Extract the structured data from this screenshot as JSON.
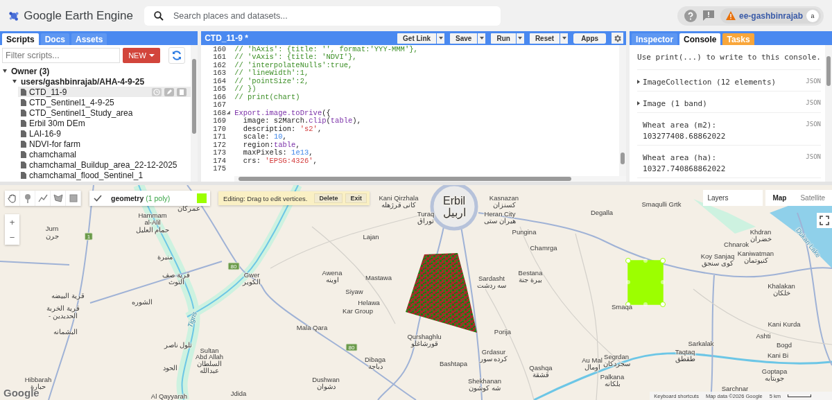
{
  "app": {
    "title": "Google Earth Engine"
  },
  "search": {
    "placeholder": "Search places and datasets..."
  },
  "account": {
    "project": "ee-gashbinrajab",
    "avatar": "a",
    "warning": true
  },
  "left_panel": {
    "tabs": [
      {
        "label": "Scripts",
        "selected": true
      },
      {
        "label": "Docs",
        "selected": false
      },
      {
        "label": "Assets",
        "selected": false
      }
    ],
    "filter": {
      "placeholder": "Filter scripts..."
    },
    "new_button": "NEW",
    "tree": [
      {
        "kind": "folder",
        "label": "Owner (3)",
        "expanded": true,
        "children": [
          {
            "kind": "folder",
            "label": "users/gashbinrajab/AHA-4-9-25",
            "expanded": true,
            "children": [
              {
                "kind": "script",
                "label": "CTD_11-9",
                "selected": true
              },
              {
                "kind": "script",
                "label": "CTD_Sentinel1_4-9-25",
                "selected": false
              },
              {
                "kind": "script",
                "label": "CTD_Sentinel1_Study_area",
                "selected": false
              },
              {
                "kind": "script",
                "label": "Erbil 30m DEm",
                "selected": false
              },
              {
                "kind": "script",
                "label": "LAI-16-9",
                "selected": false
              },
              {
                "kind": "script",
                "label": "NDVI-for farm",
                "selected": false
              },
              {
                "kind": "script",
                "label": "chamchamal",
                "selected": false
              },
              {
                "kind": "script",
                "label": "chamchamal_Buildup_area_22-12-2025",
                "selected": false
              },
              {
                "kind": "script",
                "label": "chamchamal_flood_Sentinel_1",
                "selected": false
              }
            ]
          }
        ]
      }
    ]
  },
  "editor": {
    "title": "CTD_11-9 *",
    "buttons": [
      {
        "label": "Get Link",
        "dropdown": true
      },
      {
        "label": "Save",
        "dropdown": true
      },
      {
        "label": "Run",
        "dropdown": true
      },
      {
        "label": "Reset",
        "dropdown": true
      },
      {
        "label": "Apps",
        "dropdown": false
      }
    ],
    "lines": [
      {
        "number": "160",
        "foldable": false,
        "segments": [
          {
            "kind": "comment",
            "text": "// 'hAxis': {title: '', format:'YYY-MMM'},"
          }
        ]
      },
      {
        "number": "161",
        "foldable": false,
        "segments": [
          {
            "kind": "comment",
            "text": "// 'vAxis': {title: 'NDVI'},"
          }
        ]
      },
      {
        "number": "162",
        "foldable": false,
        "segments": [
          {
            "kind": "comment",
            "text": "// 'interpolateNulls':true,"
          }
        ]
      },
      {
        "number": "163",
        "foldable": false,
        "segments": [
          {
            "kind": "comment",
            "text": "// 'lineWidth':1,"
          }
        ]
      },
      {
        "number": "164",
        "foldable": false,
        "segments": [
          {
            "kind": "comment",
            "text": "// 'pointSize':2,"
          }
        ]
      },
      {
        "number": "165",
        "foldable": false,
        "segments": [
          {
            "kind": "comment",
            "text": "// })"
          }
        ]
      },
      {
        "number": "166",
        "foldable": false,
        "segments": [
          {
            "kind": "comment",
            "text": "// print(chart)"
          }
        ]
      },
      {
        "number": "167",
        "foldable": false
      },
      {
        "number": "168",
        "foldable": true,
        "segments": [
          {
            "kind": "keyword",
            "text": "Export.image.toDrive"
          },
          {
            "kind": "plain",
            "text": "({"
          }
        ]
      },
      {
        "number": "169",
        "foldable": false,
        "segments": [
          {
            "kind": "plain",
            "text": "  image: s2March."
          },
          {
            "kind": "keyword",
            "text": "clip"
          },
          {
            "kind": "plain",
            "text": "("
          },
          {
            "kind": "keyword",
            "text": "table"
          },
          {
            "kind": "plain",
            "text": "),"
          }
        ]
      },
      {
        "number": "170",
        "foldable": false,
        "segments": [
          {
            "kind": "plain",
            "text": "  description: "
          },
          {
            "kind": "string",
            "text": "'s2'"
          },
          {
            "kind": "plain",
            "text": ","
          }
        ]
      },
      {
        "number": "171",
        "foldable": false,
        "segments": [
          {
            "kind": "plain",
            "text": "  scale: "
          },
          {
            "kind": "number",
            "text": "10"
          },
          {
            "kind": "plain",
            "text": ","
          }
        ]
      },
      {
        "number": "172",
        "foldable": false,
        "segments": [
          {
            "kind": "plain",
            "text": "  region:"
          },
          {
            "kind": "keyword",
            "text": "table"
          },
          {
            "kind": "plain",
            "text": ","
          }
        ]
      },
      {
        "number": "173",
        "foldable": false,
        "segments": [
          {
            "kind": "plain",
            "text": "  maxPixels: "
          },
          {
            "kind": "number",
            "text": "1e13"
          },
          {
            "kind": "plain",
            "text": ","
          }
        ]
      },
      {
        "number": "174",
        "foldable": false,
        "segments": [
          {
            "kind": "plain",
            "text": "  crs: "
          },
          {
            "kind": "string",
            "text": "'EPSG:4326'"
          },
          {
            "kind": "plain",
            "text": ","
          }
        ]
      },
      {
        "number": "175",
        "foldable": false
      }
    ]
  },
  "right_panel": {
    "tabs": [
      {
        "label": "Inspector",
        "selected": false,
        "highlighted": false
      },
      {
        "label": "Console",
        "selected": true,
        "highlighted": false
      },
      {
        "label": "Tasks",
        "selected": false,
        "highlighted": true
      }
    ],
    "console": {
      "hint": "Use print(...) to write to this console.",
      "entries": [
        {
          "kind": "collapsible",
          "text": "ImageCollection (12 elements)",
          "tag": "JSON"
        },
        {
          "kind": "collapsible",
          "text": "Image (1 band)",
          "tag": "JSON"
        },
        {
          "kind": "value",
          "text": "Wheat area (m2):",
          "value": "103277408.68862022",
          "tag": "JSON"
        },
        {
          "kind": "value",
          "text": "Wheat area (ha):",
          "value": "10327.740868862022",
          "tag": "JSON"
        }
      ]
    }
  },
  "map": {
    "tools": [
      {
        "kind": "hand"
      },
      {
        "kind": "point"
      },
      {
        "kind": "line"
      },
      {
        "kind": "polygon"
      },
      {
        "kind": "rectangle"
      }
    ],
    "layer": {
      "name": "geometry",
      "count": "(1 poly)",
      "visible": true,
      "color": "#9cff00"
    },
    "editing": {
      "message": "Editing: Drag to edit vertices.",
      "buttons": [
        "Delete",
        "Exit"
      ]
    },
    "zoom": [
      "+",
      "−"
    ],
    "layers_button": "Layers",
    "map_types": [
      {
        "label": "Map",
        "selected": true
      },
      {
        "label": "Satellite",
        "selected": false
      }
    ],
    "road_shields": [
      "1",
      "80",
      "80"
    ],
    "labels": [
      {
        "kind": "place",
        "text": "عمركان"
      },
      {
        "kind": "place",
        "text": "Hammam"
      },
      {
        "kind": "place",
        "text": "al-Alil"
      },
      {
        "kind": "place",
        "text": "Jurn"
      },
      {
        "kind": "place",
        "text": "حمام العليل"
      },
      {
        "kind": "place",
        "text": "جرن"
      },
      {
        "kind": "place",
        "text": "منيرة"
      },
      {
        "kind": "place",
        "text": "قرية صف"
      },
      {
        "kind": "place",
        "text": "التوث"
      },
      {
        "kind": "place",
        "text": "Gwer"
      },
      {
        "kind": "place",
        "text": "الكوير"
      },
      {
        "kind": "place",
        "text": "قرية البيضه"
      },
      {
        "kind": "place",
        "text": "الشوره"
      },
      {
        "kind": "place",
        "text": "قرية الخربة"
      },
      {
        "kind": "place",
        "text": "- الحديدين"
      },
      {
        "kind": "place",
        "text": "البشمانه"
      },
      {
        "kind": "river",
        "text": "Tigris"
      },
      {
        "kind": "place",
        "text": "تلول ناصر"
      },
      {
        "kind": "place",
        "text": "Sultan"
      },
      {
        "kind": "place",
        "text": "Abd Allah"
      },
      {
        "kind": "place",
        "text": "السلطان"
      },
      {
        "kind": "place",
        "text": "الحود"
      },
      {
        "kind": "place",
        "text": "عبدالله"
      },
      {
        "kind": "place",
        "text": "Hibbarah"
      },
      {
        "kind": "place",
        "text": "حبارة"
      },
      {
        "kind": "place",
        "text": "Al Qayyarah"
      },
      {
        "kind": "place",
        "text": "Jdida"
      },
      {
        "kind": "place",
        "text": "Dushwan"
      },
      {
        "kind": "place",
        "text": "دشوان"
      },
      {
        "kind": "place",
        "text": "Dibaga"
      },
      {
        "kind": "place",
        "text": "دباجة"
      },
      {
        "kind": "place",
        "text": "Mala Qara"
      },
      {
        "kind": "place",
        "text": "Mastawa"
      },
      {
        "kind": "place",
        "text": "Siyaw"
      },
      {
        "kind": "place",
        "text": "Helawa"
      },
      {
        "kind": "place",
        "text": "Kar Group"
      },
      {
        "kind": "place",
        "text": "Awena"
      },
      {
        "kind": "place",
        "text": "اوینه"
      },
      {
        "kind": "place",
        "text": "Lajan"
      },
      {
        "kind": "place",
        "text": "Kani Qirzhala"
      },
      {
        "kind": "place",
        "text": "کانی قرژهله"
      },
      {
        "kind": "city",
        "text": "Erbil"
      },
      {
        "kind": "city",
        "text": "اربيل"
      },
      {
        "kind": "place",
        "text": "Kasnazan"
      },
      {
        "kind": "place",
        "text": "کسنزان"
      },
      {
        "kind": "place",
        "text": "Turaq"
      },
      {
        "kind": "place",
        "text": "توراق"
      },
      {
        "kind": "place",
        "text": "Heran City"
      },
      {
        "kind": "place",
        "text": "هيران ستى"
      },
      {
        "kind": "place",
        "text": "Pungina"
      },
      {
        "kind": "place",
        "text": "Chamrga"
      },
      {
        "kind": "place",
        "text": "Degalla"
      },
      {
        "kind": "place",
        "text": "Smaqulli Grtk"
      },
      {
        "kind": "place",
        "text": "Sardasht"
      },
      {
        "kind": "place",
        "text": "سه ردشت"
      },
      {
        "kind": "place",
        "text": "Bestana"
      },
      {
        "kind": "place",
        "text": "بيرة جنة"
      },
      {
        "kind": "place",
        "text": "Khdran"
      },
      {
        "kind": "place",
        "text": "خضران"
      },
      {
        "kind": "place",
        "text": "Chnarok"
      },
      {
        "kind": "place",
        "text": "Koy Sanjaq"
      },
      {
        "kind": "place",
        "text": "كوى سنجق"
      },
      {
        "kind": "place",
        "text": "Kaniwatman"
      },
      {
        "kind": "place",
        "text": "كنيوتمان"
      },
      {
        "kind": "lake",
        "text": "Dukan Lake"
      },
      {
        "kind": "place",
        "text": "Khalakan"
      },
      {
        "kind": "place",
        "text": "خلكان"
      },
      {
        "kind": "place",
        "text": "Smaqa"
      },
      {
        "kind": "place",
        "text": "Porija"
      },
      {
        "kind": "place",
        "text": "Kani Kurda"
      },
      {
        "kind": "place",
        "text": "Ashti"
      },
      {
        "kind": "place",
        "text": "Grdasur"
      },
      {
        "kind": "place",
        "text": "كرده سور"
      },
      {
        "kind": "place",
        "text": "Sarkalak"
      },
      {
        "kind": "place",
        "text": "Taqtaq"
      },
      {
        "kind": "place",
        "text": "طقطق"
      },
      {
        "kind": "place",
        "text": "Bogd"
      },
      {
        "kind": "place",
        "text": "Bashtapa"
      },
      {
        "kind": "place",
        "text": "Au Mal"
      },
      {
        "kind": "place",
        "text": "اومال"
      },
      {
        "kind": "place",
        "text": "Segrdan"
      },
      {
        "kind": "place",
        "text": "سجردكان"
      },
      {
        "kind": "place",
        "text": "Qashqa"
      },
      {
        "kind": "place",
        "text": "قشقة"
      },
      {
        "kind": "place",
        "text": "Kani Bi"
      },
      {
        "kind": "place",
        "text": "Goptapa"
      },
      {
        "kind": "place",
        "text": "Palkana"
      },
      {
        "kind": "place",
        "text": "جوبتابه"
      },
      {
        "kind": "place",
        "text": "بلكانه"
      },
      {
        "kind": "place",
        "text": "Shekhanan"
      },
      {
        "kind": "place",
        "text": "شه كوشون"
      },
      {
        "kind": "place",
        "text": "Sarchnar"
      },
      {
        "kind": "place",
        "text": "Qurshaghlu"
      },
      {
        "kind": "place",
        "text": "قورشاغلو"
      }
    ],
    "logo": "Google",
    "attribution": [
      "Keyboard shortcuts",
      "Map data ©2026 Google"
    ],
    "scale": "5 km"
  }
}
